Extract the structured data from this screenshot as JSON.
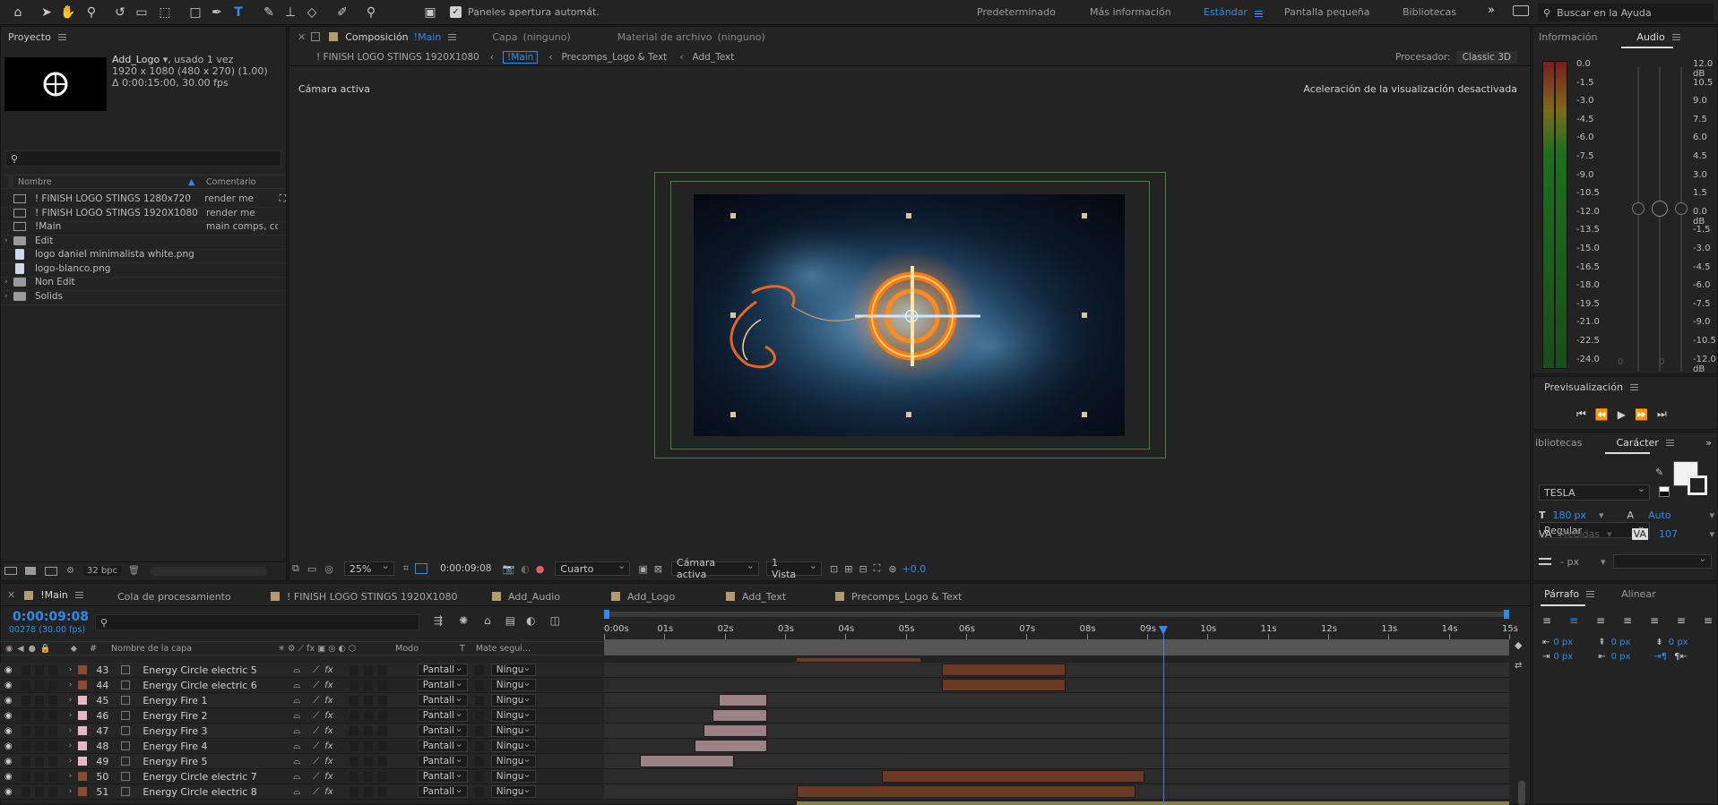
{
  "toolbar": {
    "auto_open_label": "Paneles apertura automát.",
    "workspaces": [
      "Predeterminado",
      "Más información",
      "Estándar",
      "Pantalla pequeña",
      "Bibliotecas"
    ],
    "active_workspace": "Estándar",
    "search_placeholder": "Buscar en la Ayuda"
  },
  "project": {
    "title": "Proyecto",
    "item_name": "Add_Logo",
    "item_used": ", usado 1 vez",
    "item_size": "1920 x 1080  (480 x 270) (1.00)",
    "item_duration": "Δ 0:00:15:00, 30.00 fps",
    "col_name": "Nombre",
    "col_comment": "Comentario",
    "items": [
      {
        "name": "! FINISH LOGO STINGS 1280x720",
        "comment": "render me",
        "type": "comp"
      },
      {
        "name": "! FINISH LOGO STINGS 1920X1080",
        "comment": "render me",
        "type": "comp"
      },
      {
        "name": "!Main",
        "comment": "main comps, co",
        "type": "comp"
      },
      {
        "name": "Edit",
        "comment": "",
        "type": "folder"
      },
      {
        "name": "logo daniel minimalista white.png",
        "comment": "",
        "type": "file"
      },
      {
        "name": "logo-blanco.png",
        "comment": "",
        "type": "file"
      },
      {
        "name": "Non Edit",
        "comment": "",
        "type": "folder"
      },
      {
        "name": "Solids",
        "comment": "",
        "type": "folder"
      }
    ],
    "bpc": "32 bpc"
  },
  "composition": {
    "tab_label": "Composición",
    "tab_name": "!Main",
    "layer_tab": "Capa",
    "layer_value": "(ninguno)",
    "footage_tab": "Material de archivo",
    "footage_value": "(ninguno)",
    "breadcrumbs": [
      "! FINISH LOGO STINGS 1920X1080",
      "!Main",
      "Precomps_Logo & Text",
      "Add_Text"
    ],
    "renderer_label": "Procesador:",
    "renderer_value": "Classic 3D",
    "active_camera": "Cámara activa",
    "accel_msg": "Aceleración de la visualización desactivada",
    "zoom": "25%",
    "timecode": "0:00:09:08",
    "resolution": "Cuarto",
    "camera": "Cámara activa",
    "views": "1 Vista",
    "exposure": "+0.0"
  },
  "info_audio": {
    "info_tab": "Información",
    "audio_tab": "Audio",
    "left_scale": [
      "0.0",
      "-1.5",
      "-3.0",
      "-4.5",
      "-6.0",
      "-7.5",
      "-9.0",
      "-10.5",
      "-12.0",
      "-13.5",
      "-15.0",
      "-16.5",
      "-18.0",
      "-19.5",
      "-21.0",
      "-22.5",
      "-24.0"
    ],
    "right_scale": [
      "12.0 dB",
      "10.5",
      "9.0",
      "7.5",
      "6.0",
      "4.5",
      "3.0",
      "1.5",
      "0.0 dB",
      "-1.5",
      "-3.0",
      "-4.5",
      "-6.0",
      "-7.5",
      "-9.0",
      "-10.5",
      "-12.0 dB"
    ],
    "fader_zero_a": "0",
    "fader_zero_b": "0"
  },
  "preview": {
    "title": "Previsualización"
  },
  "character": {
    "libraries_tab": "ibliotecas",
    "title": "Carácter",
    "font": "TESLA",
    "style": "Regular",
    "size": "180",
    "size_unit": "px",
    "leading": "Auto",
    "kerning": "Medidas",
    "tracking": "107",
    "stroke": "- px"
  },
  "paragraph": {
    "title": "Párrafo",
    "align_tab": "Alinear",
    "indent_values": [
      "0 px",
      "0 px",
      "0 px",
      "0 px",
      "0 px"
    ]
  },
  "timeline": {
    "tabs": [
      "!Main",
      "Cola de procesamiento",
      "! FINISH LOGO STINGS 1920X1080",
      "Add_Audio",
      "Add_Logo",
      "Add_Text",
      "Precomps_Logo & Text"
    ],
    "current_time": "0:00:09:08",
    "frame_info": "00278 (30.00 fps)",
    "col_num": "#",
    "col_name": "Nombre de la capa",
    "col_mode": "Modo",
    "col_t": "T",
    "col_matte": "Mate segui...",
    "ruler": [
      "0:00s",
      "01s",
      "02s",
      "03s",
      "04s",
      "05s",
      "06s",
      "07s",
      "08s",
      "09s",
      "10s",
      "11s",
      "12s",
      "13s",
      "14s",
      "15s"
    ],
    "playhead_seconds": 9.27,
    "duration_seconds": 15,
    "layers": [
      {
        "num": "43",
        "name": "Energy Circle electric 5",
        "mode": "Pantall",
        "matte": "Ningu",
        "label": "#8a4a2e",
        "bar_start": 5.6,
        "bar_end": 7.65,
        "bar_color": "#6b3a25"
      },
      {
        "num": "44",
        "name": "Energy Circle electric 6",
        "mode": "Pantall",
        "matte": "Ningu",
        "label": "#8a4a2e",
        "bar_start": 5.6,
        "bar_end": 7.65,
        "bar_color": "#6b3a25"
      },
      {
        "num": "45",
        "name": "Energy Fire 1",
        "mode": "Pantall",
        "matte": "Ningu",
        "label": "#e7b7c4",
        "bar_start": 1.9,
        "bar_end": 2.7,
        "bar_color": "#9c8187"
      },
      {
        "num": "46",
        "name": "Energy Fire 2",
        "mode": "Pantall",
        "matte": "Ningu",
        "label": "#e7b7c4",
        "bar_start": 1.8,
        "bar_end": 2.7,
        "bar_color": "#9c8187"
      },
      {
        "num": "47",
        "name": "Energy Fire 3",
        "mode": "Pantall",
        "matte": "Ningu",
        "label": "#e7b7c4",
        "bar_start": 1.65,
        "bar_end": 2.7,
        "bar_color": "#9c8187"
      },
      {
        "num": "48",
        "name": "Energy Fire 4",
        "mode": "Pantall",
        "matte": "Ningu",
        "label": "#e7b7c4",
        "bar_start": 1.5,
        "bar_end": 2.7,
        "bar_color": "#9c8187"
      },
      {
        "num": "49",
        "name": "Energy Fire 5",
        "mode": "Pantall",
        "matte": "Ningu",
        "label": "#e7b7c4",
        "bar_start": 0.6,
        "bar_end": 2.15,
        "bar_color": "#9c8187"
      },
      {
        "num": "50",
        "name": "Energy Circle electric 7",
        "mode": "Pantall",
        "matte": "Ningu",
        "label": "#8a4a2e",
        "bar_start": 4.6,
        "bar_end": 8.95,
        "bar_color": "#6b3a25"
      },
      {
        "num": "51",
        "name": "Energy Circle electric 8",
        "mode": "Pantall",
        "matte": "Ningu",
        "label": "#8a4a2e",
        "bar_start": 3.2,
        "bar_end": 8.8,
        "bar_color": "#6b3a25"
      }
    ]
  }
}
